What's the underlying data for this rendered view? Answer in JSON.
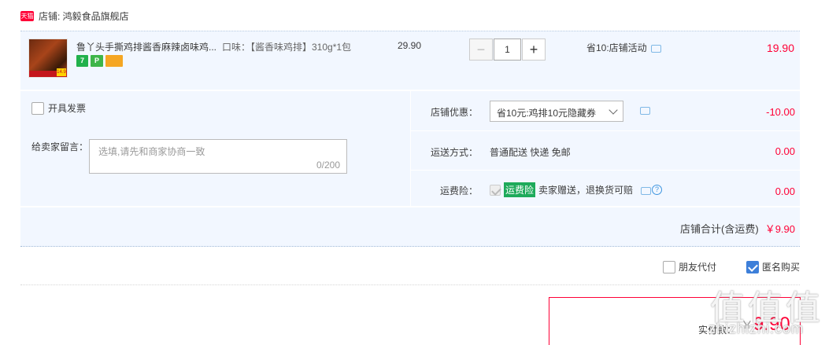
{
  "shop": {
    "badge": "天猫",
    "label": "店铺: 鸿毅食品旗舰店"
  },
  "item": {
    "title": "鲁丫头手撕鸡排酱香麻辣卤味鸡...",
    "spec": "口味：【酱香味鸡排】310g*1包",
    "thumb_tag": "14.9",
    "service_icons": [
      "7",
      "P",
      "card-icon"
    ],
    "unit_price": "29.90",
    "quantity": "1",
    "qty_dec": "−",
    "qty_inc": "+",
    "promo": "省10:店铺活动",
    "total": "19.90"
  },
  "options": {
    "invoice_label": "开具发票",
    "invoice_checked": false,
    "memo_label": "给卖家留言：",
    "memo_placeholder": "选填,请先和商家协商一致",
    "memo_count": "0/200"
  },
  "right": {
    "coupon_label": "店铺优惠：",
    "coupon_value": "省10元:鸡排10元隐藏券",
    "coupon_amount": "-10.00",
    "shipping_label": "运送方式：",
    "shipping_value": "普通配送 快递 免邮",
    "shipping_amount": "0.00",
    "insurance_label": "运费险：",
    "insurance_badge": "运费险",
    "insurance_value": "卖家赠送，退换货可赔",
    "insurance_help": "?",
    "insurance_amount": "0.00"
  },
  "subtotal": {
    "label": "店铺合计(含运费)",
    "amount": "￥9.90"
  },
  "payment": {
    "friend_pay_label": "朋友代付",
    "anonymous_label": "匿名购买",
    "anonymous_checked": true
  },
  "final": {
    "label": "实付款：",
    "yen": "￥",
    "amount": "9.90"
  },
  "watermark": {
    "glyphs": [
      "值",
      "值",
      "值"
    ],
    "text": "zhizhizhi.com"
  },
  "colors": {
    "accent": "#ff0036",
    "panel": "#f2f7ff",
    "check": "#3d7fd9",
    "insurance": "#1eaa5a"
  }
}
